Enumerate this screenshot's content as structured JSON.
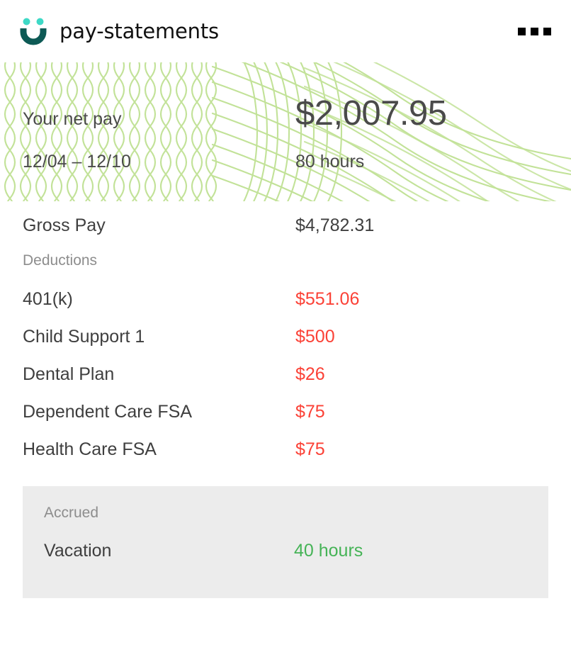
{
  "app": {
    "title": "pay-statements",
    "logo_icon": "smiley-u-logo-icon",
    "logo_eye_color": "#3ed9c6",
    "logo_mouth_color": "#0d5a55",
    "overflow_icon": "more-options-icon"
  },
  "banner": {
    "net_pay_label": "Your net pay",
    "net_pay_amount": "$2,007.95",
    "period": "12/04 – 12/10",
    "hours": "80 hours",
    "pattern_color": "#c2e298"
  },
  "summary": {
    "gross_pay_label": "Gross Pay",
    "gross_pay_value": "$4,782.31"
  },
  "deductions": {
    "heading": "Deductions",
    "color": "#fb4136",
    "items": [
      {
        "label": "401(k)",
        "amount": "$551.06"
      },
      {
        "label": "Child Support 1",
        "amount": "$500"
      },
      {
        "label": "Dental Plan",
        "amount": "$26"
      },
      {
        "label": "Dependent Care FSA",
        "amount": "$75"
      },
      {
        "label": "Health Care FSA",
        "amount": "$75"
      }
    ]
  },
  "accrued": {
    "heading": "Accrued",
    "color": "#45b356",
    "items": [
      {
        "label": "Vacation",
        "amount": "40 hours"
      }
    ]
  }
}
